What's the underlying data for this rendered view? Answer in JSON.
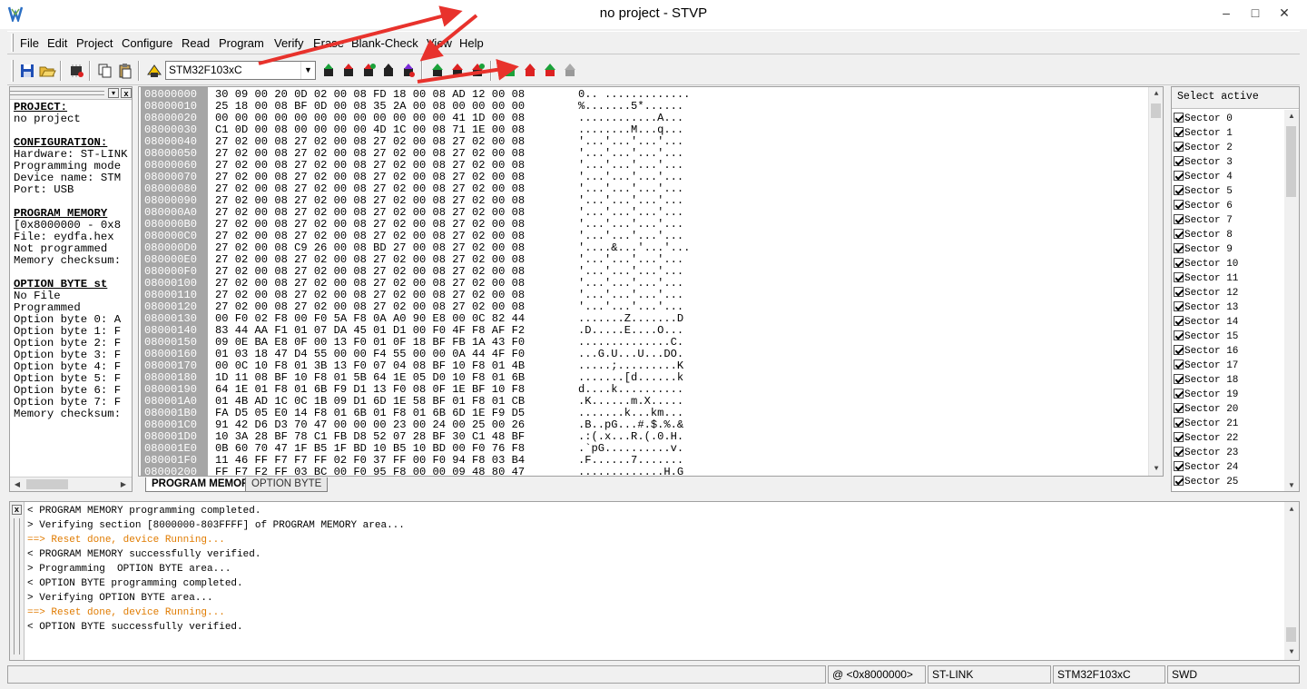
{
  "window": {
    "title": "no project - STVP",
    "minimize": "–",
    "maximize": "□",
    "close": "✕"
  },
  "menu": [
    "File",
    "Edit",
    "Project",
    "Configure",
    "Read",
    "Program",
    "Verify",
    "Erase",
    "Blank-Check",
    "View",
    "Help"
  ],
  "toolbar": {
    "device": "STM32F103xC",
    "icons": [
      "save-icon",
      "open-icon",
      "chip-icon",
      "copy-icon",
      "paste-icon",
      "device-icon",
      "read-icon",
      "read-current-icon",
      "read-all-icon",
      "read-option-icon",
      "read-verify-icon",
      "program-icon",
      "program-current-icon",
      "program-all-icon",
      "verify-icon",
      "verify-current-icon",
      "erase-icon",
      "blank-check-icon"
    ]
  },
  "left_panel": {
    "lines": [
      {
        "t": "PROJECT:",
        "h": true
      },
      {
        "t": "no project"
      },
      {
        "t": ""
      },
      {
        "t": "CONFIGURATION:",
        "h": true
      },
      {
        "t": "Hardware: ST-LINK"
      },
      {
        "t": "Programming mode"
      },
      {
        "t": "Device name: STM"
      },
      {
        "t": "Port: USB"
      },
      {
        "t": ""
      },
      {
        "t": "PROGRAM MEMORY",
        "h": true
      },
      {
        "t": "[0x8000000 - 0x8"
      },
      {
        "t": "File: eydfa.hex"
      },
      {
        "t": "Not programmed"
      },
      {
        "t": "Memory checksum:"
      },
      {
        "t": ""
      },
      {
        "t": "OPTION BYTE st",
        "h": true
      },
      {
        "t": "No File"
      },
      {
        "t": "Programmed"
      },
      {
        "t": "Option byte 0: A"
      },
      {
        "t": "Option byte 1: F"
      },
      {
        "t": "Option byte 2: F"
      },
      {
        "t": "Option byte 3: F"
      },
      {
        "t": "Option byte 4: F"
      },
      {
        "t": "Option byte 5: F"
      },
      {
        "t": "Option byte 6: F"
      },
      {
        "t": "Option byte 7: F"
      },
      {
        "t": "Memory checksum:"
      }
    ]
  },
  "hex_rows": [
    [
      "08000000",
      "30 09 00 20 0D 02 00 08 FD 18 00 08 AD 12 00 08",
      "0.. ............."
    ],
    [
      "08000010",
      "25 18 00 08 BF 0D 00 08 35 2A 00 08 00 00 00 00",
      "%.......5*......"
    ],
    [
      "08000020",
      "00 00 00 00 00 00 00 00 00 00 00 00 41 1D 00 08",
      "............A..."
    ],
    [
      "08000030",
      "C1 0D 00 08 00 00 00 00 4D 1C 00 08 71 1E 00 08",
      "........M...q..."
    ],
    [
      "08000040",
      "27 02 00 08 27 02 00 08 27 02 00 08 27 02 00 08",
      "'...'...'...'..."
    ],
    [
      "08000050",
      "27 02 00 08 27 02 00 08 27 02 00 08 27 02 00 08",
      "'...'...'...'..."
    ],
    [
      "08000060",
      "27 02 00 08 27 02 00 08 27 02 00 08 27 02 00 08",
      "'...'...'...'..."
    ],
    [
      "08000070",
      "27 02 00 08 27 02 00 08 27 02 00 08 27 02 00 08",
      "'...'...'...'..."
    ],
    [
      "08000080",
      "27 02 00 08 27 02 00 08 27 02 00 08 27 02 00 08",
      "'...'...'...'..."
    ],
    [
      "08000090",
      "27 02 00 08 27 02 00 08 27 02 00 08 27 02 00 08",
      "'...'...'...'..."
    ],
    [
      "080000A0",
      "27 02 00 08 27 02 00 08 27 02 00 08 27 02 00 08",
      "'...'...'...'..."
    ],
    [
      "080000B0",
      "27 02 00 08 27 02 00 08 27 02 00 08 27 02 00 08",
      "'...'...'...'..."
    ],
    [
      "080000C0",
      "27 02 00 08 27 02 00 08 27 02 00 08 27 02 00 08",
      "'...'...'...'..."
    ],
    [
      "080000D0",
      "27 02 00 08 C9 26 00 08 BD 27 00 08 27 02 00 08",
      "'....&...'...'..."
    ],
    [
      "080000E0",
      "27 02 00 08 27 02 00 08 27 02 00 08 27 02 00 08",
      "'...'...'...'..."
    ],
    [
      "080000F0",
      "27 02 00 08 27 02 00 08 27 02 00 08 27 02 00 08",
      "'...'...'...'..."
    ],
    [
      "08000100",
      "27 02 00 08 27 02 00 08 27 02 00 08 27 02 00 08",
      "'...'...'...'..."
    ],
    [
      "08000110",
      "27 02 00 08 27 02 00 08 27 02 00 08 27 02 00 08",
      "'...'...'...'..."
    ],
    [
      "08000120",
      "27 02 00 08 27 02 00 08 27 02 00 08 27 02 00 08",
      "'...'...'...'..."
    ],
    [
      "08000130",
      "00 F0 02 F8 00 F0 5A F8 0A A0 90 E8 00 0C 82 44",
      ".......Z.......D"
    ],
    [
      "08000140",
      "83 44 AA F1 01 07 DA 45 01 D1 00 F0 4F F8 AF F2",
      ".D.....E....O..."
    ],
    [
      "08000150",
      "09 0E BA E8 0F 00 13 F0 01 0F 18 BF FB 1A 43 F0",
      "..............C."
    ],
    [
      "08000160",
      "01 03 18 47 D4 55 00 00 F4 55 00 00 0A 44 4F F0",
      "...G.U...U...DO."
    ],
    [
      "08000170",
      "00 0C 10 F8 01 3B 13 F0 07 04 08 BF 10 F8 01 4B",
      ".....;.........K"
    ],
    [
      "08000180",
      "1D 11 08 BF 10 F8 01 5B 64 1E 05 D0 10 F8 01 6B",
      ".......[d......k"
    ],
    [
      "08000190",
      "64 1E 01 F8 01 6B F9 D1 13 F0 08 0F 1E BF 10 F8",
      "d....k.........."
    ],
    [
      "080001A0",
      "01 4B AD 1C 0C 1B 09 D1 6D 1E 58 BF 01 F8 01 CB",
      ".K......m.X....."
    ],
    [
      "080001B0",
      "FA D5 05 E0 14 F8 01 6B 01 F8 01 6B 6D 1E F9 D5",
      ".......k...km..."
    ],
    [
      "080001C0",
      "91 42 D6 D3 70 47 00 00 00 23 00 24 00 25 00 26",
      ".B..pG...#.$.%.&"
    ],
    [
      "080001D0",
      "10 3A 28 BF 78 C1 FB D8 52 07 28 BF 30 C1 48 BF",
      ".:(.x...R.(.0.H."
    ],
    [
      "080001E0",
      "0B 60 70 47 1F B5 1F BD 10 B5 10 BD 00 F0 76 F8",
      ".`pG..........v."
    ],
    [
      "080001F0",
      "11 46 FF F7 F7 FF 02 F0 37 FF 00 F0 94 F8 03 B4",
      ".F......7......."
    ],
    [
      "08000200",
      "FF F7 F2 FF 03 BC 00 F0 95 F8 00 00 09 48 80 47",
      ".............H.G"
    ]
  ],
  "tabs": [
    "PROGRAM MEMORY",
    "OPTION BYTE"
  ],
  "sectors": {
    "header": "Select active",
    "items": [
      "Sector 0",
      "Sector 1",
      "Sector 2",
      "Sector 3",
      "Sector 4",
      "Sector 5",
      "Sector 6",
      "Sector 7",
      "Sector 8",
      "Sector 9",
      "Sector 10",
      "Sector 11",
      "Sector 12",
      "Sector 13",
      "Sector 14",
      "Sector 15",
      "Sector 16",
      "Sector 17",
      "Sector 18",
      "Sector 19",
      "Sector 20",
      "Sector 21",
      "Sector 22",
      "Sector 23",
      "Sector 24",
      "Sector 25"
    ]
  },
  "log": [
    {
      "t": "< PROGRAM MEMORY programming completed.",
      "c": "black"
    },
    {
      "t": "> Verifying section [8000000-803FFFF] of PROGRAM MEMORY area...",
      "c": "black"
    },
    {
      "t": "==> Reset done, device Running...",
      "c": "orange"
    },
    {
      "t": "< PROGRAM MEMORY successfully verified.",
      "c": "black"
    },
    {
      "t": "> Programming  OPTION BYTE area...",
      "c": "black"
    },
    {
      "t": "< OPTION BYTE programming completed.",
      "c": "black"
    },
    {
      "t": "> Verifying OPTION BYTE area...",
      "c": "black"
    },
    {
      "t": "==> Reset done, device Running...",
      "c": "orange"
    },
    {
      "t": "< OPTION BYTE successfully verified.",
      "c": "black"
    }
  ],
  "status": {
    "address": "@ <0x8000000>",
    "probe": "ST-LINK",
    "device": "STM32F103xC",
    "mode": "SWD"
  },
  "colors": {
    "annotation_arrow": "#e8322c",
    "log_orange": "#e07b00",
    "address_bg": "#a6a6a6"
  }
}
